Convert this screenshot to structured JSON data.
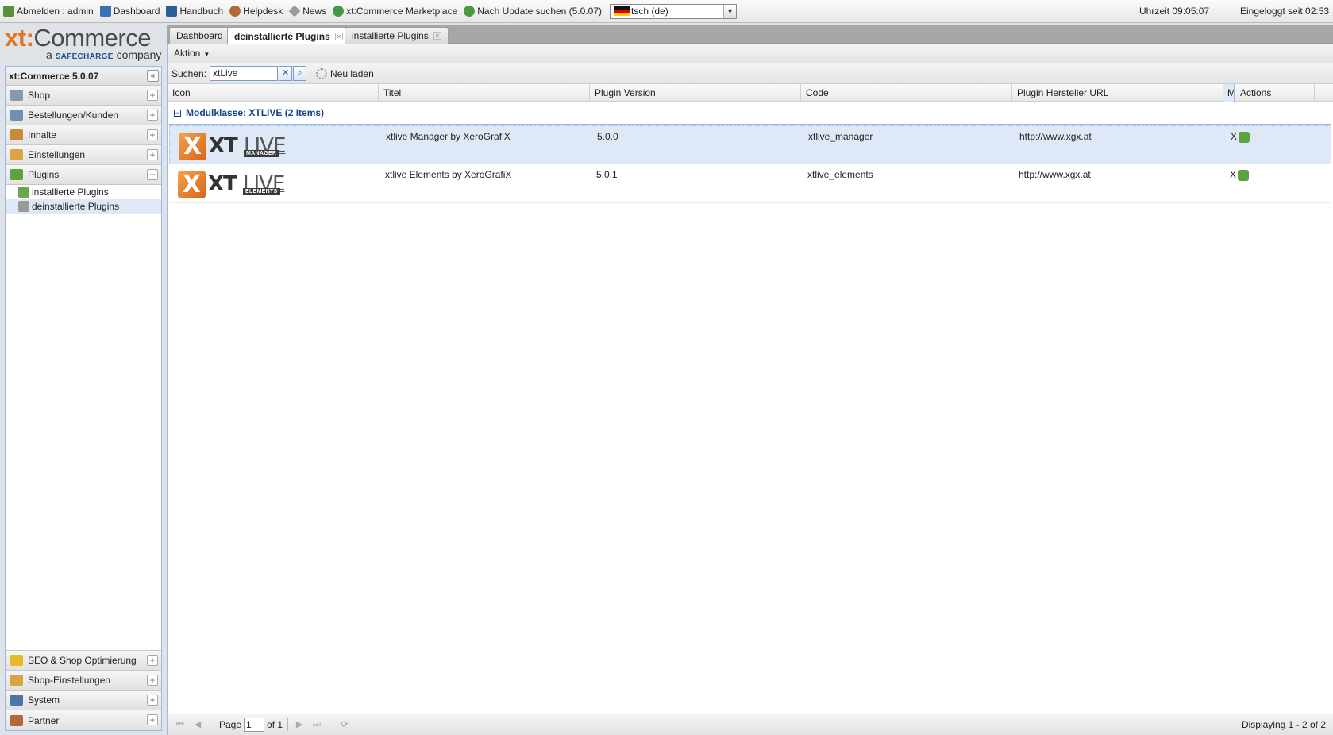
{
  "topbar": {
    "items": [
      {
        "label": "Abmelden : admin",
        "icon": "logout-icon",
        "color": "#5a8f3c"
      },
      {
        "label": "Dashboard",
        "icon": "chart-icon",
        "color": "#3c6fb4"
      },
      {
        "label": "Handbuch",
        "icon": "book-icon",
        "color": "#2b5d9b"
      },
      {
        "label": "Helpdesk",
        "icon": "person-icon",
        "color": "#b06a3a"
      },
      {
        "label": "News",
        "icon": "tag-icon",
        "color": "#9a9a9a"
      },
      {
        "label": "xt:Commerce Marketplace",
        "icon": "globe-icon",
        "color": "#3f9a4b"
      },
      {
        "label": "Nach Update suchen (5.0.07)",
        "icon": "refresh-icon",
        "color": "#4c9a3f"
      }
    ],
    "language": "tsch (de)",
    "time": "Uhrzeit 09:05:07",
    "logged_in": "Eingeloggt seit 02:53"
  },
  "logo": {
    "xt": "xt:",
    "commerce": "Commerce",
    "sub_a": "a",
    "sub_brand": "SAFECHARGE",
    "sub_company": "company"
  },
  "sidebar": {
    "title": "xt:Commerce 5.0.07",
    "sections": [
      {
        "label": "Shop",
        "icon": "cart-icon",
        "color": "#8a97a6"
      },
      {
        "label": "Bestellungen/Kunden",
        "icon": "orders-icon",
        "color": "#6f8fb3"
      },
      {
        "label": "Inhalte",
        "icon": "clipboard-icon",
        "color": "#c98a3a"
      },
      {
        "label": "Einstellungen",
        "icon": "folder-icon",
        "color": "#d9a441"
      },
      {
        "label": "Plugins",
        "icon": "puzzle-icon",
        "color": "#5aa33e"
      }
    ],
    "plugin_items": [
      {
        "label": "installierte Plugins"
      },
      {
        "label": "deinstallierte Plugins"
      }
    ],
    "bottom_sections": [
      {
        "label": "SEO & Shop Optimierung",
        "icon": "lightning-icon",
        "color": "#e8b82a"
      },
      {
        "label": "Shop-Einstellungen",
        "icon": "folder-icon",
        "color": "#d9a441"
      },
      {
        "label": "System",
        "icon": "monitor-icon",
        "color": "#4d74a8"
      },
      {
        "label": "Partner",
        "icon": "person-icon",
        "color": "#b06a3a"
      }
    ]
  },
  "tabs": [
    {
      "label": "Dashboard"
    },
    {
      "label": "deinstallierte Plugins"
    },
    {
      "label": "installierte Plugins"
    }
  ],
  "toolbar": {
    "action_label": "Aktion",
    "search_label": "Suchen:",
    "search_value": "xtLive",
    "reload_label": "Neu laden"
  },
  "grid": {
    "columns": [
      "Icon",
      "Titel",
      "Plugin Version",
      "Code",
      "Plugin Hersteller URL",
      "M",
      "Actions"
    ],
    "group_label": "Modulklasse: XTLIVE (2 Items)",
    "rows": [
      {
        "logo_badge": "MANAGER",
        "title": "xtlive Manager by XeroGrafiX",
        "version": "5.0.0",
        "code": "xtlive_manager",
        "url": "http://www.xgx.at",
        "m": "X"
      },
      {
        "logo_badge": "ELEMENTS",
        "title": "xtlive Elements by XeroGrafiX",
        "version": "5.0.1",
        "code": "xtlive_elements",
        "url": "http://www.xgx.at",
        "m": "X"
      }
    ],
    "logo_text": {
      "x": "X",
      "xt": "XT",
      "live": "LIVE"
    }
  },
  "paging": {
    "page_label": "Page",
    "page_value": "1",
    "of_label": "of 1",
    "display": "Displaying 1 - 2 of 2"
  }
}
